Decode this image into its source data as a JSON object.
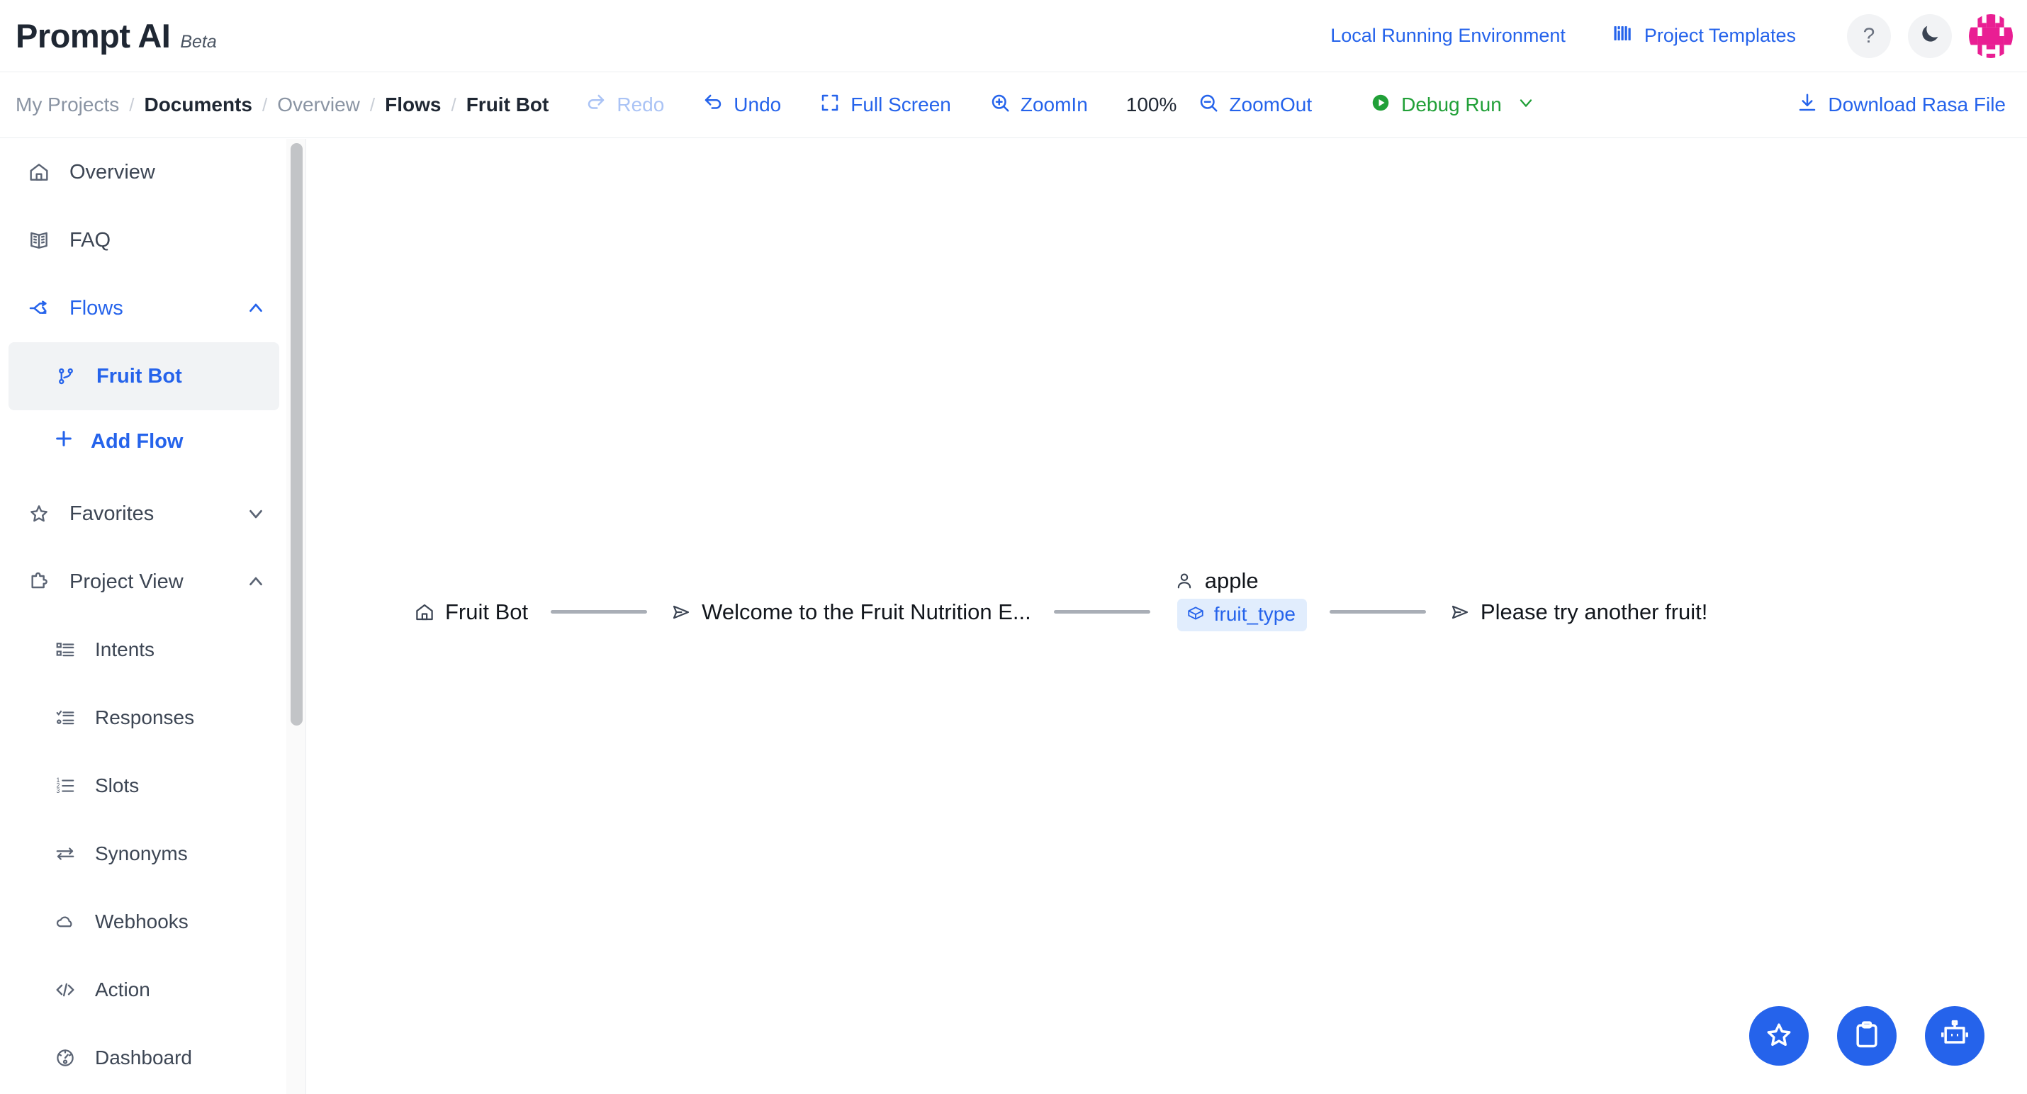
{
  "app": {
    "brand_name": "Prompt AI",
    "brand_tag": "Beta",
    "accent_blue": "#2563eb",
    "accent_green": "#21a038",
    "avatar_color": "#e91e93"
  },
  "header": {
    "env_link": "Local Running Environment",
    "templates_link": "Project Templates",
    "templates_icon": "chart-bars-icon",
    "help_icon": "?",
    "theme_icon": "moon-icon",
    "avatar_icon": "user-avatar"
  },
  "breadcrumb": [
    {
      "label": "My Projects",
      "style": "muted"
    },
    {
      "label": "Documents",
      "style": "dark"
    },
    {
      "label": "Overview",
      "style": "muted"
    },
    {
      "label": "Flows",
      "style": "dark"
    },
    {
      "label": "Fruit Bot",
      "style": "dark"
    }
  ],
  "toolbar": {
    "redo_label": "Redo",
    "undo_label": "Undo",
    "fullscreen_label": "Full Screen",
    "zoomin_label": "ZoomIn",
    "zoom_level": "100%",
    "zoomout_label": "ZoomOut",
    "debug_run_label": "Debug Run",
    "download_label": "Download Rasa File"
  },
  "sidebar": {
    "items": [
      {
        "label": "Overview",
        "icon": "home-icon"
      },
      {
        "label": "FAQ",
        "icon": "book-icon"
      },
      {
        "label": "Flows",
        "icon": "flow-branch-icon"
      },
      {
        "label": "Fruit Bot",
        "icon": "git-branch-icon"
      },
      {
        "label": "Add Flow",
        "icon": "plus-icon"
      },
      {
        "label": "Favorites",
        "icon": "star-icon"
      },
      {
        "label": "Project View",
        "icon": "puzzle-icon"
      },
      {
        "label": "Intents",
        "icon": "list-box-icon"
      },
      {
        "label": "Responses",
        "icon": "list-check-icon"
      },
      {
        "label": "Slots",
        "icon": "list-number-icon"
      },
      {
        "label": "Synonyms",
        "icon": "arrows-swap-icon"
      },
      {
        "label": "Webhooks",
        "icon": "cloud-icon"
      },
      {
        "label": "Action",
        "icon": "code-icon"
      },
      {
        "label": "Dashboard",
        "icon": "gauge-icon"
      }
    ]
  },
  "flow": {
    "nodes": [
      {
        "label": "Fruit Bot",
        "icon": "home-icon"
      },
      {
        "label": "Welcome to the Fruit Nutrition E...",
        "icon": "send-icon"
      },
      {
        "label": "apple",
        "icon": "user-icon",
        "slot": "fruit_type",
        "slot_icon": "cube-icon"
      },
      {
        "label": "Please try another fruit!",
        "icon": "send-icon"
      }
    ]
  },
  "fabs": [
    {
      "icon": "star-icon",
      "name": "favorite-fab"
    },
    {
      "icon": "clipboard-icon",
      "name": "clipboard-fab"
    },
    {
      "icon": "robot-icon",
      "name": "chatbot-fab"
    }
  ]
}
